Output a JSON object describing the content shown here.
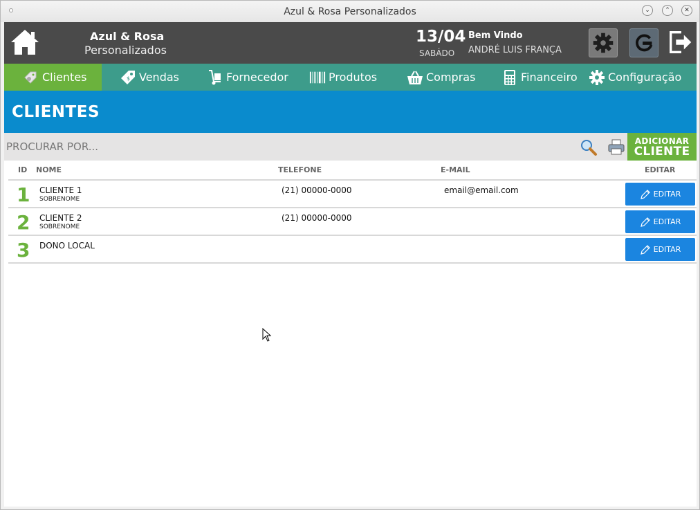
{
  "window": {
    "title": "Azul & Rosa Personalizados"
  },
  "header": {
    "brand_line1": "Azul & Rosa",
    "brand_line2": "Personalizados",
    "date": "13/04",
    "weekday": "SABÁDO",
    "welcome": "Bem Vindo",
    "user": "ANDRÉ LUIS FRANÇA"
  },
  "nav": {
    "items": [
      {
        "label": "Clientes",
        "icon": "user-tag-icon",
        "active": true
      },
      {
        "label": "Vendas",
        "icon": "price-tag-icon"
      },
      {
        "label": "Fornecedor",
        "icon": "hand-truck-icon"
      },
      {
        "label": "Produtos",
        "icon": "barcode-icon"
      },
      {
        "label": "Compras",
        "icon": "basket-icon"
      },
      {
        "label": "Financeiro",
        "icon": "calculator-icon"
      },
      {
        "label": "Configuração",
        "icon": "gear-icon"
      }
    ]
  },
  "section": {
    "title": "CLIENTES"
  },
  "search": {
    "placeholder": "PROCURAR POR..."
  },
  "add_button": {
    "line1": "ADICIONAR",
    "line2": "CLIENTE"
  },
  "table": {
    "columns": {
      "id": "ID",
      "name": "NOME",
      "phone": "TELEFONE",
      "email": "E-MAIL",
      "edit": "EDITAR"
    },
    "rows": [
      {
        "id": "1",
        "name": "CLIENTE 1",
        "surname": "SOBRENOME",
        "phone": "(21) 00000-0000",
        "email": "email@email.com",
        "edit": "EDITAR"
      },
      {
        "id": "2",
        "name": "CLIENTE 2",
        "surname": "SOBRENOME",
        "phone": "(21) 00000-0000",
        "email": "",
        "edit": "EDITAR"
      },
      {
        "id": "3",
        "name": "DONO LOCAL",
        "surname": "",
        "phone": "",
        "email": "",
        "edit": "EDITAR"
      }
    ]
  },
  "colors": {
    "header": "#4a4a4a",
    "nav": "#3d9c8b",
    "active": "#6bb23d",
    "section": "#0a8bcd",
    "edit": "#1b85e0"
  }
}
